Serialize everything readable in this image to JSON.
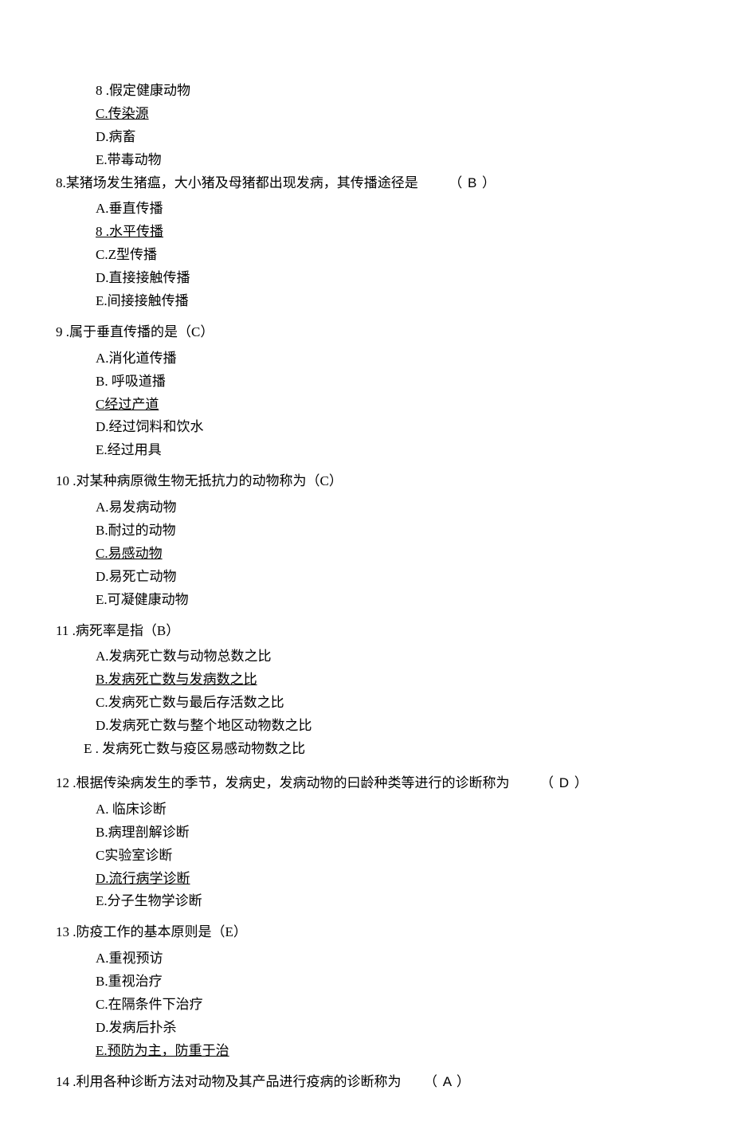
{
  "q7options_trailing": [
    {
      "label": "8 .假定健康动物",
      "underline": false,
      "indent": "indent-2"
    },
    {
      "label": "C.传染源",
      "underline": true,
      "indent": "indent-2"
    },
    {
      "label": "D.病畜",
      "underline": false,
      "indent": "indent-2"
    },
    {
      "label": "E.带毒动物",
      "underline": false,
      "indent": "indent-2"
    }
  ],
  "q8": {
    "stem": "8.某猪场发生猪瘟，大小猪及母猪都出现发病，其传播途径是",
    "answer": "（ B ）",
    "options": [
      {
        "label": "A.垂直传播",
        "underline": false
      },
      {
        "label": "8 .水平传播",
        "underline": true
      },
      {
        "label": "C.Z型传播",
        "underline": false
      },
      {
        "label": "D.直接接触传播",
        "underline": false
      },
      {
        "label": "E.间接接触传播",
        "underline": false
      }
    ]
  },
  "q9": {
    "stem": "9 .属于垂直传播的是（C）",
    "options": [
      {
        "label": "A.消化道传播",
        "underline": false
      },
      {
        "label": "B. 呼吸道播",
        "underline": false
      },
      {
        "label": "C经过产道",
        "underline": true
      },
      {
        "label": "D.经过饲料和饮水",
        "underline": false
      },
      {
        "label": "E.经过用具",
        "underline": false
      }
    ]
  },
  "q10": {
    "stem": "10 .对某种病原微生物无抵抗力的动物称为（C）",
    "options": [
      {
        "label": "A.易发病动物",
        "underline": false
      },
      {
        "label": "B.耐过的动物",
        "underline": false
      },
      {
        "label": "C.易感动物",
        "underline": true
      },
      {
        "label": "D.易死亡动物",
        "underline": false
      },
      {
        "label": "E.可凝健康动物",
        "underline": false
      }
    ]
  },
  "q11": {
    "stem": "11 .病死率是指（B）",
    "options": [
      {
        "label": "A.发病死亡数与动物总数之比",
        "underline": false
      },
      {
        "label": "B.发病死亡数与发病数之比",
        "underline": true
      },
      {
        "label": "C.发病死亡数与最后存活数之比",
        "underline": false
      },
      {
        "label": "D.发病死亡数与整个地区动物数之比",
        "underline": false
      },
      {
        "label": "E . 发病死亡数与疫区易感动物数之比",
        "underline": false,
        "indent": "indent-e"
      }
    ]
  },
  "q12": {
    "stem": "12 .根据传染病发生的季节，发病史，发病动物的曰龄种类等进行的诊断称为",
    "answer": "（ D ）",
    "options": [
      {
        "label": "A. 临床诊断",
        "underline": false
      },
      {
        "label": "B.病理剖解诊断",
        "underline": false
      },
      {
        "label": "C实验室诊断",
        "underline": false
      },
      {
        "label": "D.流行病学诊断",
        "underline": true
      },
      {
        "label": "E.分子生物学诊断",
        "underline": false
      }
    ]
  },
  "q13": {
    "stem": "13 .防疫工作的基本原则是（E）",
    "options": [
      {
        "label": "A.重视预访",
        "underline": false
      },
      {
        "label": "B.重视治疗",
        "underline": false
      },
      {
        "label": "C.在隔条件下治疗",
        "underline": false
      },
      {
        "label": "D.发病后扑杀",
        "underline": false
      },
      {
        "label": "E.预防为主，防重于治",
        "underline": true
      }
    ]
  },
  "q14": {
    "stem": "14 .利用各种诊断方法对动物及其产品进行疫病的诊断称为",
    "answer": "（ A ）"
  }
}
